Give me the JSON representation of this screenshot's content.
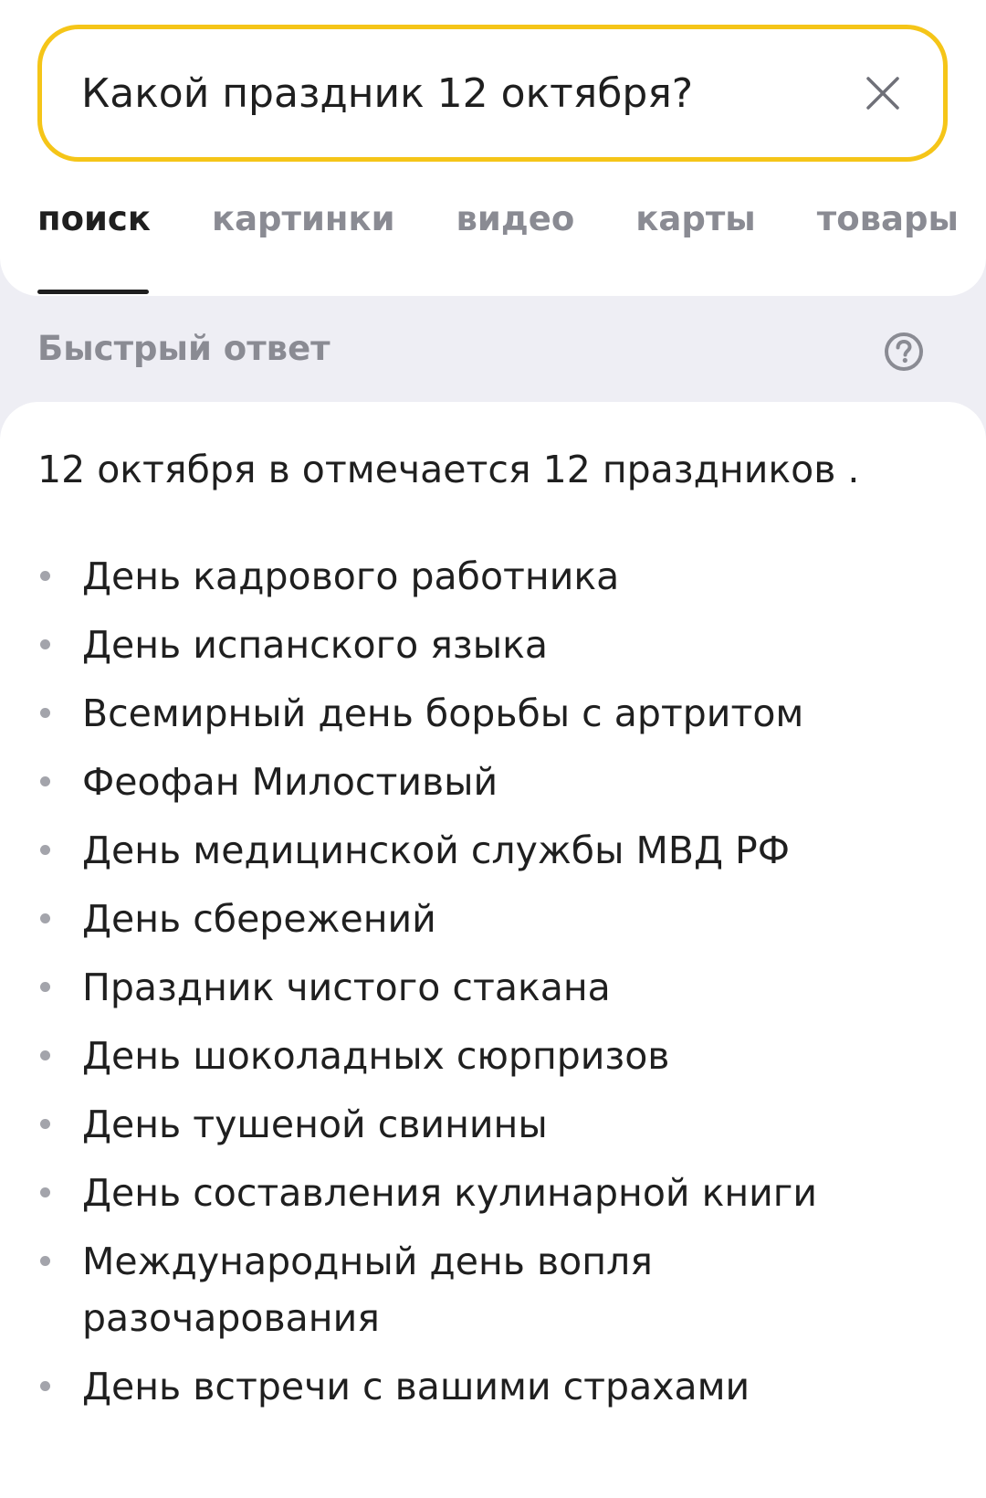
{
  "search": {
    "query": "Какой праздник 12 октября?"
  },
  "tabs": [
    {
      "label": "поиск",
      "active": true
    },
    {
      "label": "картинки",
      "active": false
    },
    {
      "label": "видео",
      "active": false
    },
    {
      "label": "карты",
      "active": false
    },
    {
      "label": "товары",
      "active": false
    }
  ],
  "quick_answer": {
    "label": "Быстрый ответ",
    "intro": "12 октября в отмечается 12 праздников .",
    "items": [
      "День кадрового работника",
      "День испанского языка",
      "Всемирный день борьбы с артритом",
      "Феофан Милостивый",
      "День медицинской службы МВД РФ",
      "День сбережений",
      "Праздник чистого стакана",
      "День шоколадных сюрпризов",
      "День тушеной свинины",
      "День составления кулинарной книги",
      "Международный день вопля разочарования",
      "День встречи с вашими страхами"
    ]
  },
  "icons": {
    "clear": "close-icon",
    "help": "question-circle-icon"
  },
  "colors": {
    "search_border": "#f5c518",
    "background": "#eeeef4",
    "card": "#ffffff",
    "text": "#1f1f1f",
    "muted": "#8a8b93"
  }
}
